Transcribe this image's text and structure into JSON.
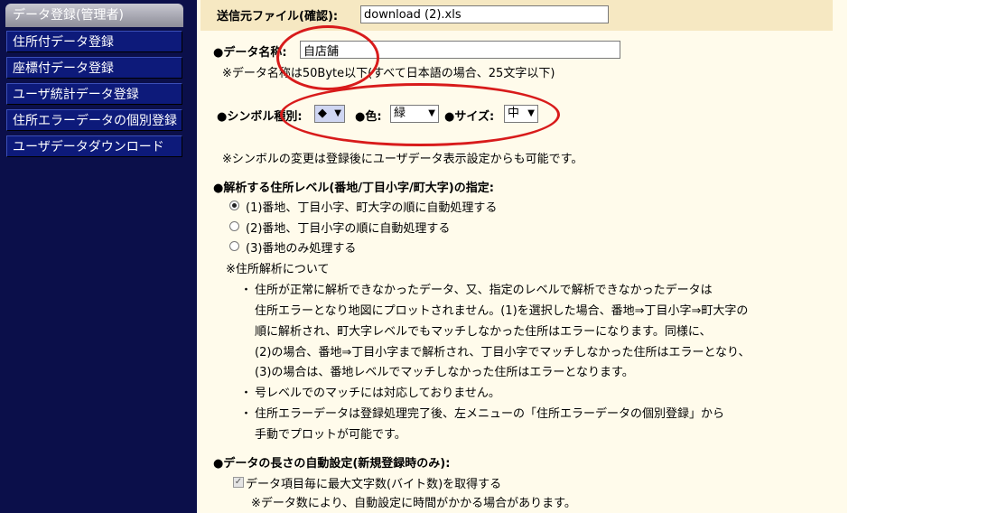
{
  "sidebar": {
    "header": "データ登録(管理者)",
    "items": [
      {
        "label": "住所付データ登録"
      },
      {
        "label": "座標付データ登録"
      },
      {
        "label": "ユーザ統計データ登録"
      },
      {
        "label": "住所エラーデータの個別登録"
      },
      {
        "label": "ユーザデータダウンロード"
      }
    ]
  },
  "source": {
    "label": "送信元ファイル(確認):",
    "value": "download (2).xls"
  },
  "name": {
    "label": "●データ名称:",
    "value": "自店舗",
    "note": "※データ名称は50Byte以下(すべて日本語の場合、25文字以下)"
  },
  "symbol": {
    "type_label": "●シンボル種別:",
    "type_value": "◆",
    "color_label": "●色:",
    "color_value": "緑",
    "size_label": "●サイズ:",
    "size_value": "中",
    "note": "※シンボルの変更は登録後にユーザデータ表示設定からも可能です。"
  },
  "analysis": {
    "heading": "●解析する住所レベル(番地/丁目小字/町大字)の指定:",
    "options": [
      {
        "label": "(1)番地、丁目小字、町大字の順に自動処理する",
        "selected": true
      },
      {
        "label": "(2)番地、丁目小字の順に自動処理する",
        "selected": false
      },
      {
        "label": "(3)番地のみ処理する",
        "selected": false
      }
    ],
    "about": "※住所解析について",
    "bullet1_lines": [
      "住所が正常に解析できなかったデータ、又、指定のレベルで解析できなかったデータは",
      "住所エラーとなり地図にプロットされません。(1)を選択した場合、番地⇒丁目小字⇒町大字の",
      "順に解析され、町大字レベルでもマッチしなかった住所はエラーになります。同様に、",
      "(2)の場合、番地⇒丁目小字まで解析され、丁目小字でマッチしなかった住所はエラーとなり、",
      "(3)の場合は、番地レベルでマッチしなかった住所はエラーとなります。"
    ],
    "bullet2": "号レベルでのマッチには対応しておりません。",
    "bullet3_lines": [
      "住所エラーデータは登録処理完了後、左メニューの「住所エラーデータの個別登録」から",
      "手動でプロットが可能です。"
    ]
  },
  "length": {
    "heading": "●データの長さの自動設定(新規登録時のみ):",
    "checkbox_label": "データ項目毎に最大文字数(バイト数)を取得する",
    "note": "※データ数により、自動設定に時間がかかる場合があります。"
  },
  "colors": {
    "sidebar_bg": "#0b0f4a",
    "menu_item_bg": "#0d1a7a",
    "form_bg": "#fffbeb",
    "highlight_circle": "#d81b1b"
  }
}
